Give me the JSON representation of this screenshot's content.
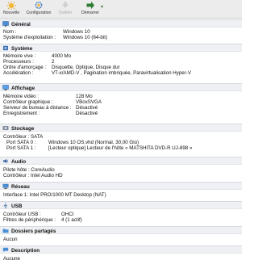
{
  "toolbar": {
    "buttons": [
      {
        "label": "Nouvelle",
        "icon": "new-sun-icon"
      },
      {
        "label": "Configuration",
        "icon": "settings-gear-icon"
      },
      {
        "label": "Oublier",
        "icon": "discard-arrow-icon"
      },
      {
        "label": "Démarrer",
        "icon": "start-arrow-icon"
      }
    ]
  },
  "colors": {
    "section_header_bg": "#eef0f3",
    "toolbar_bg": "#ececec",
    "start_green": "#2e7d32",
    "new_yellow": "#f2b632",
    "gear_blue": "#3a78c2"
  },
  "sections": {
    "general": {
      "title": "Général",
      "icon": "general-screen-icon",
      "rows": [
        {
          "key": "Nom :",
          "value": "Windows 10"
        },
        {
          "key": "Système d'exploitation :",
          "value": "Windows 10 (64-bit)"
        }
      ]
    },
    "system": {
      "title": "Système",
      "icon": "system-chip-icon",
      "rows": [
        {
          "key": "Mémoire vive :",
          "value": "4000 Mo"
        },
        {
          "key": "Processeurs :",
          "value": "2"
        },
        {
          "key": "Ordre d'amorçage :",
          "value": "Disquette, Optique, Disque dur"
        },
        {
          "key": "Accélération :",
          "value": "VT-x/AMD-V , Pagination imbriquée, Paravirtualisation Hyper-V"
        }
      ]
    },
    "display": {
      "title": "Affichage",
      "icon": "display-monitor-icon",
      "rows": [
        {
          "key": "Mémoire vidéo :",
          "value": "128 Mo"
        },
        {
          "key": "Contrôleur graphique :",
          "value": "VBoxSVGA"
        },
        {
          "key": "Serveur de bureau à distance :",
          "value": "Désactivé"
        },
        {
          "key": "Enregistrement :",
          "value": "Désactivé"
        }
      ]
    },
    "storage": {
      "title": "Stockage",
      "icon": "storage-disk-icon",
      "rows": [
        {
          "key": "Contrôleur : SATA",
          "value": ""
        },
        {
          "key": "Port SATA 0 :",
          "value": "Windows 10 OS.vhd (Normal, 30,00 Gio)"
        },
        {
          "key": "Port SATA 1 :",
          "value": "[Lecteur optique] Lecteur de l'hôte « MATSHITA DVD-R   UJ-898 »"
        }
      ]
    },
    "audio": {
      "title": "Audio",
      "icon": "audio-speaker-icon",
      "rows": [
        {
          "key": "Pilote hôte : CoreAudio",
          "value": ""
        },
        {
          "key": "Contrôleur : Intel Audio HD",
          "value": ""
        }
      ]
    },
    "network": {
      "title": "Réseau",
      "icon": "network-icon",
      "rows": [
        {
          "key": "Interface 1:  Intel PRO/1000 MT Desktop (NAT)",
          "value": ""
        }
      ]
    },
    "usb": {
      "title": "USB",
      "icon": "usb-icon",
      "rows": [
        {
          "key": "Contrôleur USB :",
          "value": "OHCI"
        },
        {
          "key": "Filtres de périphérique :",
          "value": "4 (1 actif)"
        }
      ]
    },
    "shared": {
      "title": "Dossiers partagés",
      "icon": "shared-folder-icon",
      "rows": [
        {
          "key": "Aucun",
          "value": ""
        }
      ]
    },
    "description": {
      "title": "Description",
      "icon": "description-speech-icon",
      "rows": [
        {
          "key": "Aucune",
          "value": ""
        }
      ]
    }
  }
}
